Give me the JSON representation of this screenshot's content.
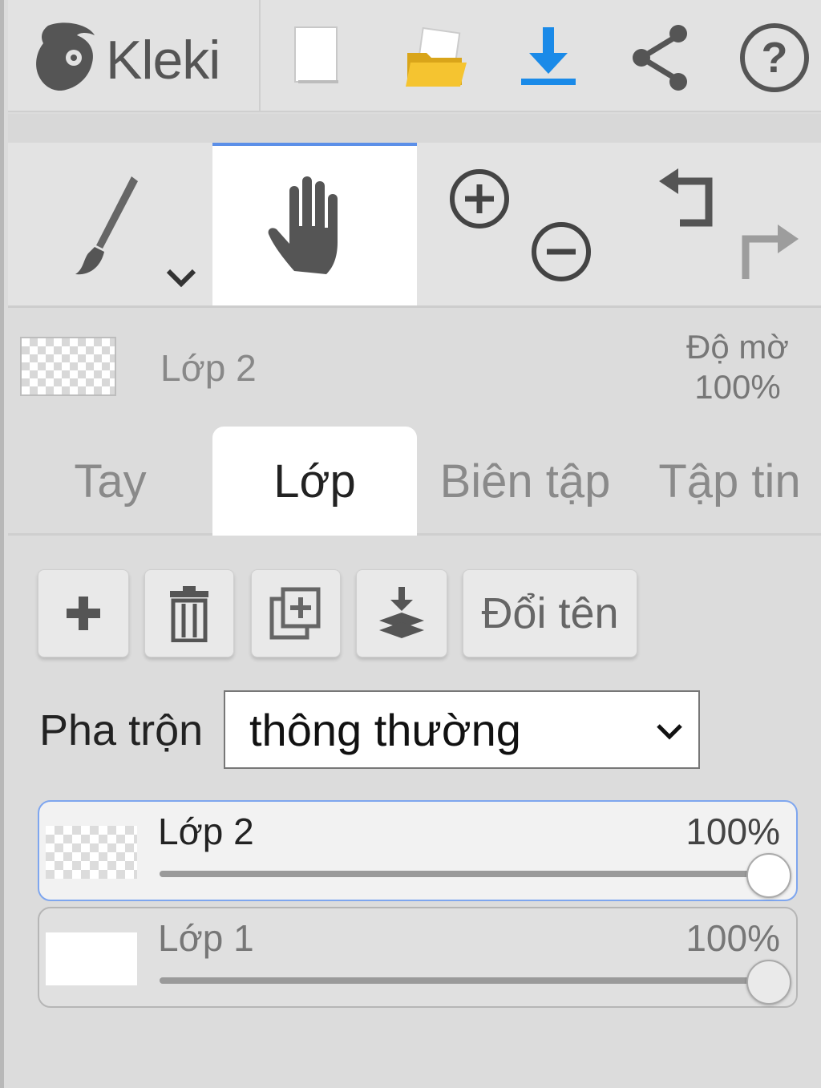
{
  "app": {
    "name": "Kleki"
  },
  "toolbar": {
    "new_icon": "new-file-icon",
    "open_icon": "folder-open-icon",
    "save_icon": "download-icon",
    "share_icon": "share-icon",
    "help_icon": "help-icon",
    "accent": "#1a8ae8"
  },
  "tools": {
    "brush_icon": "brush-icon",
    "hand_icon": "hand-icon",
    "zoom_in_icon": "zoom-in-icon",
    "zoom_out_icon": "zoom-out-icon",
    "undo_icon": "undo-icon",
    "redo_icon": "redo-icon",
    "active_tool": "hand"
  },
  "current_layer": {
    "name": "Lớp 2",
    "opacity_label": "Độ mờ",
    "opacity_value": "100%"
  },
  "tabs": [
    {
      "label": "Tay",
      "active": false
    },
    {
      "label": "Lớp",
      "active": true
    },
    {
      "label": "Biên tập",
      "active": false
    },
    {
      "label": "Tập tin",
      "active": false
    }
  ],
  "actions": {
    "add_icon": "plus-icon",
    "delete_icon": "trash-icon",
    "duplicate_icon": "duplicate-icon",
    "merge_icon": "merge-down-icon",
    "rename_label": "Đổi tên"
  },
  "blend": {
    "label": "Pha trộn",
    "value": "thông thường"
  },
  "layers": [
    {
      "name": "Lớp 2",
      "opacity": "100%",
      "opacity_fraction": 1.0,
      "selected": true,
      "thumb": "transparent"
    },
    {
      "name": "Lớp 1",
      "opacity": "100%",
      "opacity_fraction": 1.0,
      "selected": false,
      "thumb": "white"
    }
  ]
}
